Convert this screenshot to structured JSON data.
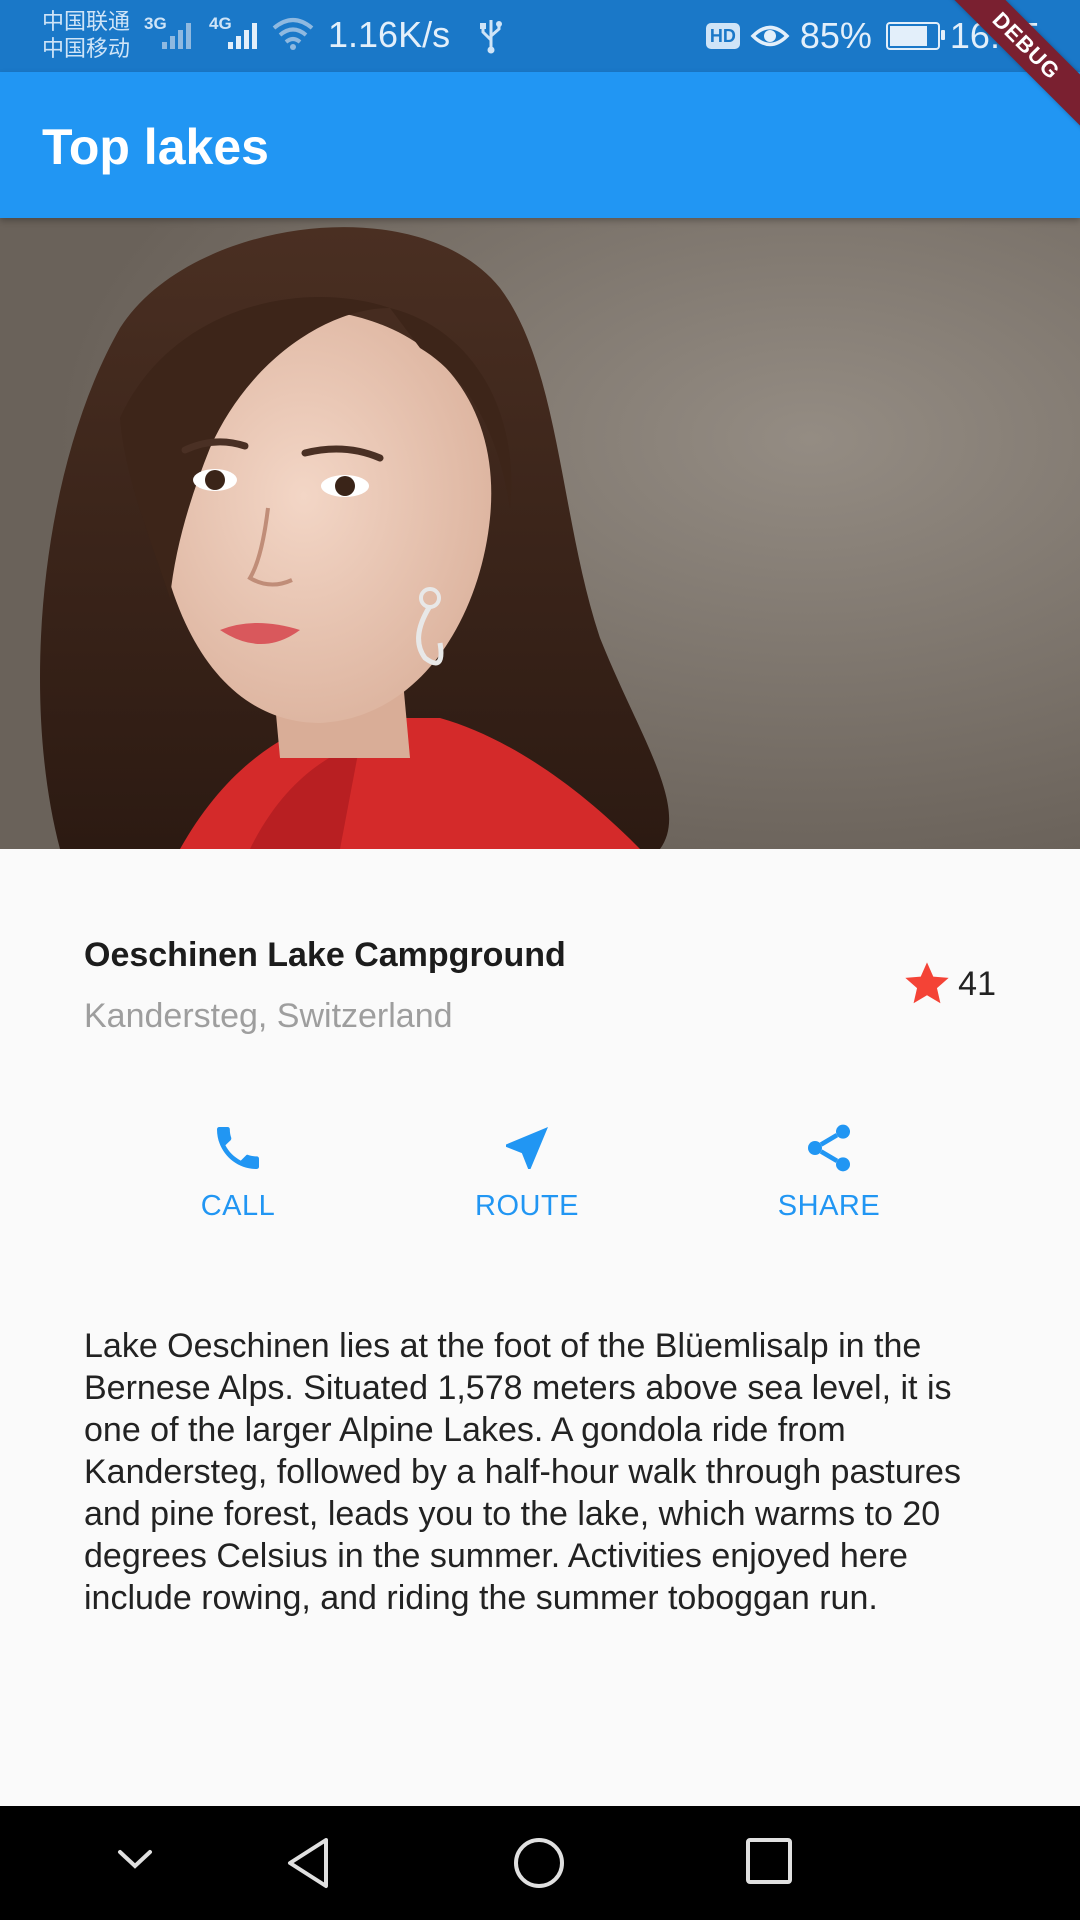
{
  "status_bar": {
    "carrier_1": "中国联通",
    "carrier_2": "中国移动",
    "network_1": "3G",
    "network_2": "4G",
    "speed": "1.16K/s",
    "hd": "HD",
    "battery": "85%",
    "battery_level": 0.85,
    "time": "16:55"
  },
  "debug_banner": "DEBUG",
  "app_bar": {
    "title": "Top lakes"
  },
  "place": {
    "name": "Oeschinen Lake Campground",
    "location": "Kandersteg, Switzerland",
    "favorite_count": "41"
  },
  "actions": [
    {
      "label": "CALL",
      "icon": "phone-icon"
    },
    {
      "label": "ROUTE",
      "icon": "near-me-icon"
    },
    {
      "label": "SHARE",
      "icon": "share-icon"
    }
  ],
  "description": "Lake Oeschinen lies at the foot of the Blüemlisalp in the Bernese Alps. Situated 1,578 meters above sea level, it is one of the larger Alpine Lakes. A gondola ride from Kandersteg, followed by a half-hour walk through pastures and pine forest, leads you to the lake, which warms to 20 degrees Celsius in the summer. Activities enjoyed here include rowing, and riding the summer toboggan run.",
  "colors": {
    "primary": "#2196f3",
    "status_bar": "#1a78c8",
    "star": "#f44336",
    "secondary_text": "#9e9e9e"
  }
}
